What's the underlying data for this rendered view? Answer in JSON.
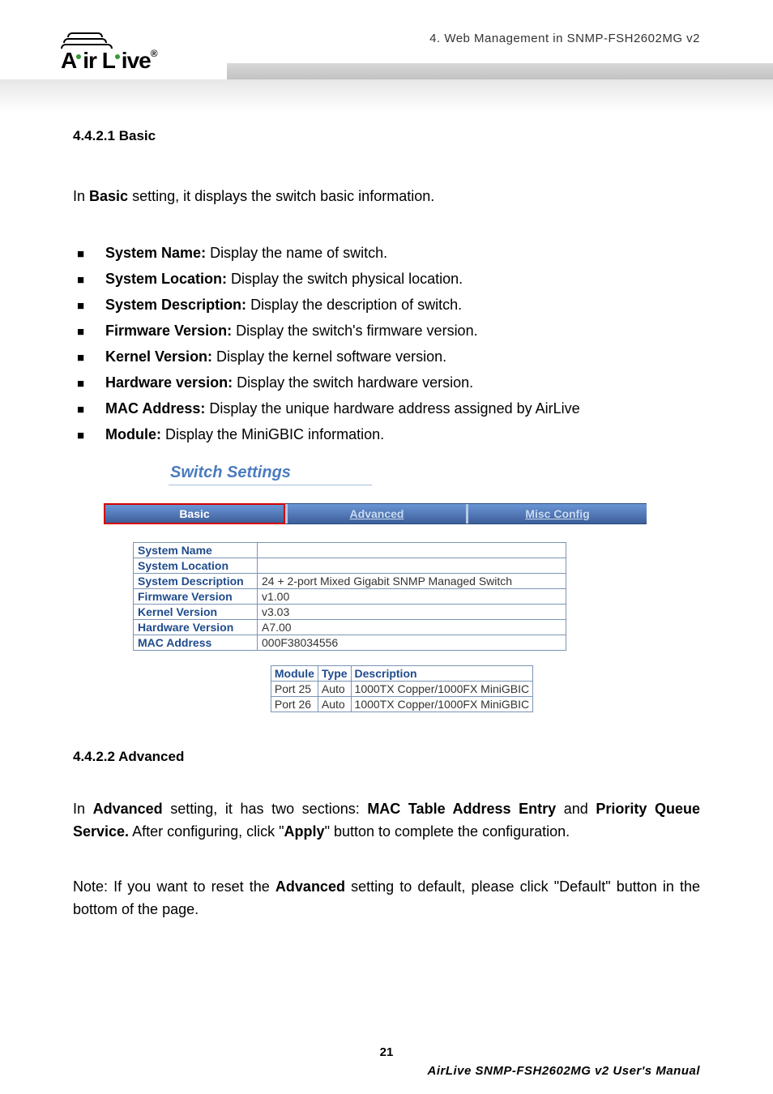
{
  "header": {
    "brand": "Air Live",
    "breadcrumb": "4.  Web Management in SNMP-FSH2602MG v2"
  },
  "sections": {
    "basic_title": "4.4.2.1 Basic",
    "basic_intro_prefix": "In ",
    "basic_intro_bold": "Basic",
    "basic_intro_suffix": " setting, it displays the switch basic information.",
    "bullets": [
      {
        "label": "System Name:",
        "desc": " Display the name of switch."
      },
      {
        "label": "System Location:",
        "desc": " Display the switch physical location."
      },
      {
        "label": "System Description:",
        "desc": " Display the description of switch."
      },
      {
        "label": "Firmware Version:",
        "desc": " Display the switch's firmware version."
      },
      {
        "label": "Kernel Version:",
        "desc": " Display the kernel software version."
      },
      {
        "label": "Hardware version:",
        "desc": " Display the switch hardware version."
      },
      {
        "label": "MAC Address:",
        "desc": " Display the unique hardware address assigned by AirLive"
      },
      {
        "label": "Module:",
        "desc": " Display the MiniGBIC information."
      }
    ],
    "switch_settings_title": "Switch Settings",
    "tabs": {
      "basic": "Basic",
      "advanced": "Advanced",
      "misc": "Misc Config"
    },
    "info_table": [
      {
        "k": "System Name",
        "v": ""
      },
      {
        "k": "System Location",
        "v": ""
      },
      {
        "k": "System Description",
        "v": "24 + 2-port Mixed Gigabit SNMP Managed Switch"
      },
      {
        "k": "Firmware Version",
        "v": "v1.00"
      },
      {
        "k": "Kernel Version",
        "v": "v3.03"
      },
      {
        "k": "Hardware Version",
        "v": "A7.00"
      },
      {
        "k": "MAC Address",
        "v": "000F38034556"
      }
    ],
    "module_table": {
      "head": [
        "Module",
        "Type",
        "Description"
      ],
      "rows": [
        [
          "Port 25",
          "Auto",
          "1000TX Copper/1000FX MiniGBIC"
        ],
        [
          "Port 26",
          "Auto",
          "1000TX Copper/1000FX MiniGBIC"
        ]
      ]
    },
    "adv_title": "4.4.2.2 Advanced",
    "adv_p1": {
      "a": "In ",
      "b": "Advanced",
      "c": " setting, it has two sections: ",
      "d": "MAC Table Address Entry",
      "e": " and ",
      "f": "Priority Queue Service.",
      "g": " After configuring, click \"",
      "h": "Apply",
      "i": "\" button to complete the configuration."
    },
    "adv_p2": {
      "a": "Note: If you want to reset the ",
      "b": "Advanced",
      "c": " setting to default, please click \"Default\" button in the bottom of the page."
    }
  },
  "footer": {
    "page": "21",
    "manual": "AirLive SNMP-FSH2602MG v2 User's Manual"
  }
}
